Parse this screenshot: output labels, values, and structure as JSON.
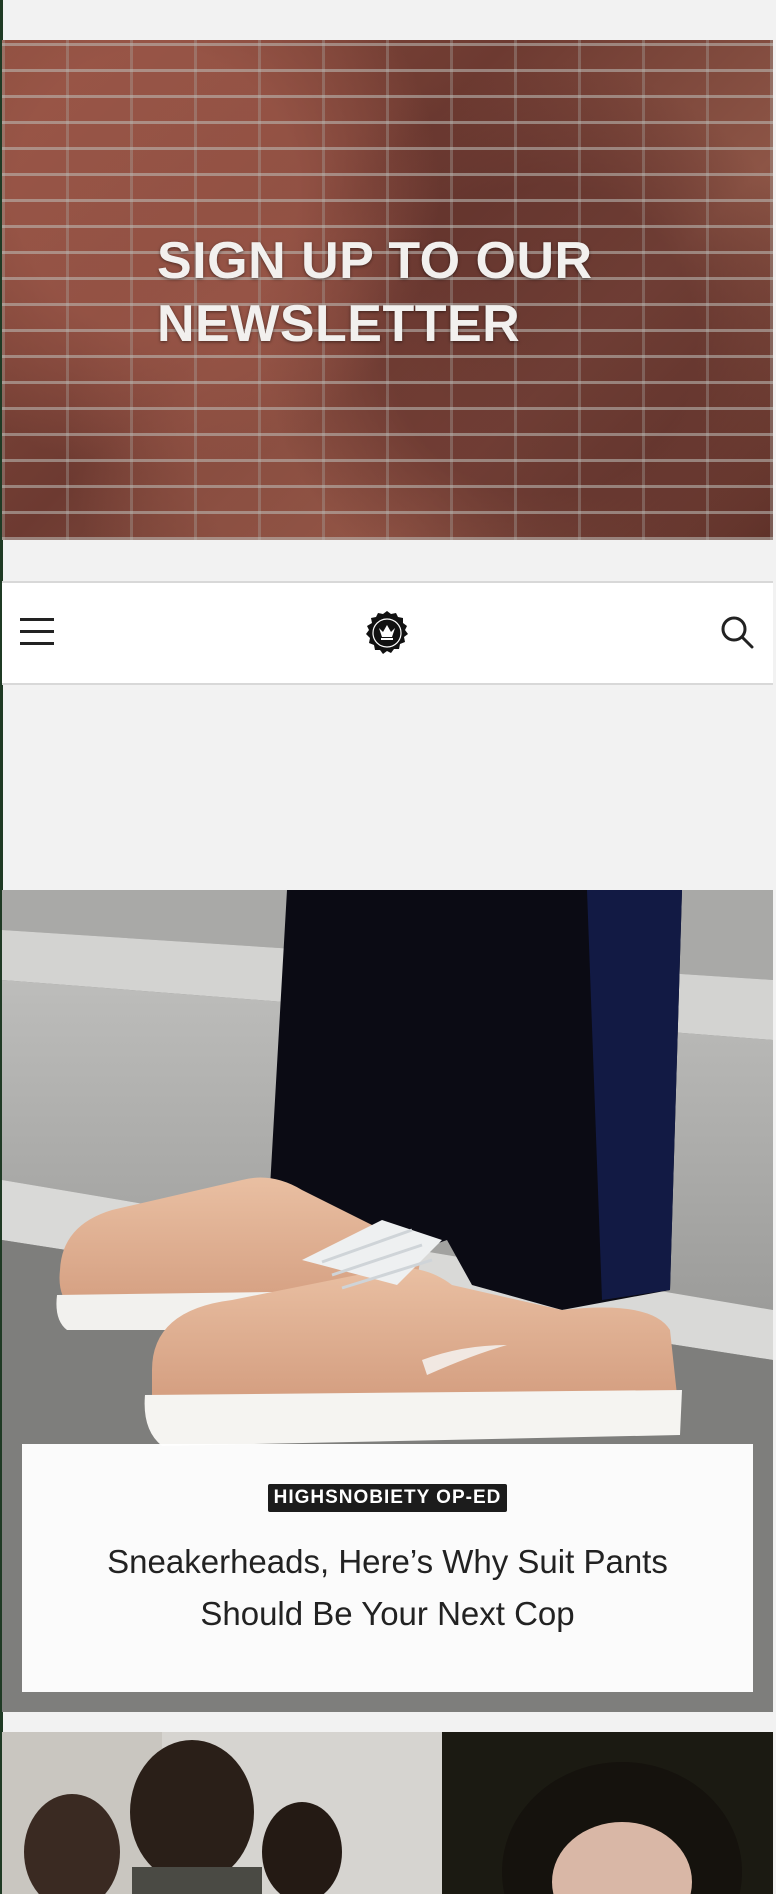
{
  "banner": {
    "title": "SIGN UP TO OUR\nNEWSLETTER"
  },
  "header": {
    "menu_icon": "hamburger-menu-icon",
    "logo_icon": "crown-seal-logo-icon",
    "search_icon": "search-icon"
  },
  "featured_article": {
    "tag": "HIGHSNOBIETY OP-ED",
    "headline": "Sneakerheads, Here’s Why Suit Pants Should Be Your Next Cop"
  },
  "colors": {
    "page_background": "#f2f2f2",
    "tag_background": "#1c1c1c",
    "headline_text": "#222222"
  }
}
